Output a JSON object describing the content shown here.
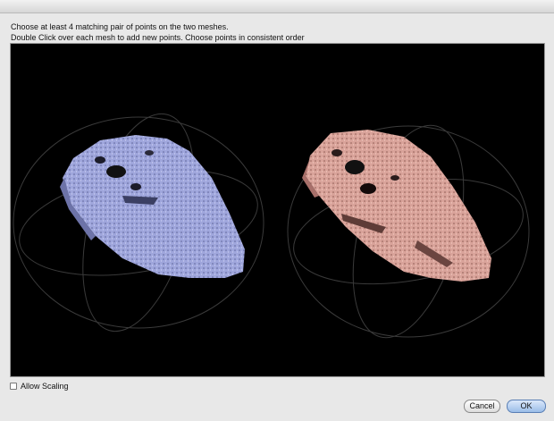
{
  "dialog": {
    "instruction_line1": "Choose at least 4 matching pair of points on the two meshes.",
    "instruction_line2": "Double Click over each mesh to add new points. Choose points in consistent order"
  },
  "viewport": {
    "background_color": "#000000",
    "left_mesh_color": "#9fa6dc",
    "right_mesh_color": "#d9a39a",
    "trackball_color": "#3a3a3a"
  },
  "options": {
    "allow_scaling_label": "Allow Scaling",
    "allow_scaling_checked": false
  },
  "buttons": {
    "cancel_label": "Cancel",
    "ok_label": "OK"
  }
}
